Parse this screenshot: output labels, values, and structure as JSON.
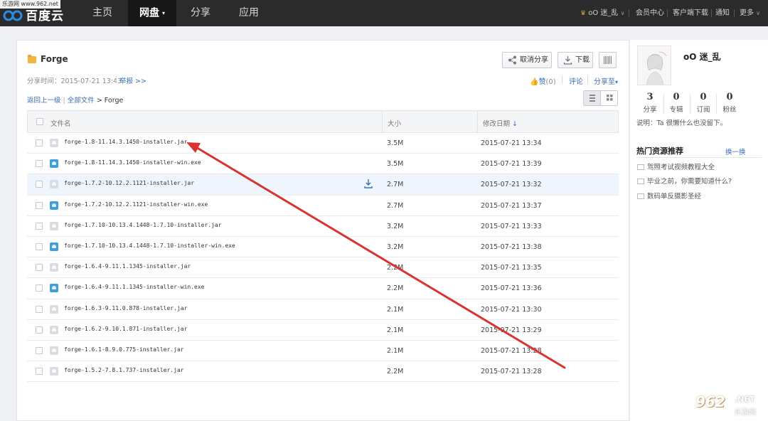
{
  "watermark": {
    "top_left": "乐游网 www.962.net",
    "bottom_right_big": "962",
    "bottom_right_net": ".NET",
    "bottom_right_cn": "乐游网"
  },
  "app": {
    "logo_text": "百度云"
  },
  "nav": {
    "items": [
      {
        "label": "主页"
      },
      {
        "label": "网盘",
        "active": true
      },
      {
        "label": "分享"
      },
      {
        "label": "应用"
      }
    ],
    "user": "oO 迷_乱",
    "links": [
      "会员中心",
      "客户端下载",
      "通知",
      "更多"
    ]
  },
  "share": {
    "folder_name": "Forge",
    "share_time": "分享时间：2015-07-21 13:43",
    "report": "举报 >>",
    "cancel_share": "取消分享",
    "download": "下载",
    "like": "赞",
    "like_count": "(0)",
    "comment": "评论",
    "share_to": "分享至",
    "breadcrumb": {
      "back": "返回上一级",
      "all_files": "全部文件",
      "current": "> Forge"
    }
  },
  "table": {
    "headers": {
      "name": "文件名",
      "size": "大小",
      "date": "修改日期"
    },
    "rows": [
      {
        "name": "forge-1.8-11.14.3.1450-installer.jar",
        "type": "jar",
        "size": "3.5M",
        "date": "2015-07-21 13:34"
      },
      {
        "name": "forge-1.8-11.14.3.1450-installer-win.exe",
        "type": "exe",
        "size": "3.5M",
        "date": "2015-07-21 13:39"
      },
      {
        "name": "forge-1.7.2-10.12.2.1121-installer.jar",
        "type": "jar",
        "size": "2.7M",
        "date": "2015-07-21 13:32",
        "hover": true
      },
      {
        "name": "forge-1.7.2-10.12.2.1121-installer-win.exe",
        "type": "exe",
        "size": "2.7M",
        "date": "2015-07-21 13:37"
      },
      {
        "name": "forge-1.7.10-10.13.4.1448-1.7.10-installer.jar",
        "type": "jar",
        "size": "3.2M",
        "date": "2015-07-21 13:33"
      },
      {
        "name": "forge-1.7.10-10.13.4.1448-1.7.10-installer-win.exe",
        "type": "exe",
        "size": "3.2M",
        "date": "2015-07-21 13:38"
      },
      {
        "name": "forge-1.6.4-9.11.1.1345-installer.jar",
        "type": "jar",
        "size": "2.2M",
        "date": "2015-07-21 13:35"
      },
      {
        "name": "forge-1.6.4-9.11.1.1345-installer-win.exe",
        "type": "exe",
        "size": "2.2M",
        "date": "2015-07-21 13:36"
      },
      {
        "name": "forge-1.6.3-9.11.0.878-installer.jar",
        "type": "jar",
        "size": "2.1M",
        "date": "2015-07-21 13:30"
      },
      {
        "name": "forge-1.6.2-9.10.1.871-installer.jar",
        "type": "jar",
        "size": "2.1M",
        "date": "2015-07-21 13:29"
      },
      {
        "name": "forge-1.6.1-8.9.0.775-installer.jar",
        "type": "jar",
        "size": "2.1M",
        "date": "2015-07-21 13:28"
      },
      {
        "name": "forge-1.5.2-7.8.1.737-installer.jar",
        "type": "jar",
        "size": "2.2M",
        "date": "2015-07-21 13:28"
      }
    ]
  },
  "profile": {
    "name": "oO 迷_乱",
    "stats": [
      {
        "num": "3",
        "label": "分享"
      },
      {
        "num": "0",
        "label": "专辑"
      },
      {
        "num": "0",
        "label": "订阅"
      },
      {
        "num": "0",
        "label": "粉丝"
      }
    ],
    "bio": "说明：Ta 很懒什么也没留下。"
  },
  "hot": {
    "title": "热门资源推荐",
    "more": "换一换",
    "items": [
      "驾照考试视频教程大全",
      "毕业之前，你需要知道什么?",
      "数码单反摄影圣经"
    ]
  },
  "colors": {
    "topbar": "#2b2b2b",
    "link": "#3a6fb4",
    "arrow": "#d9342f",
    "folder": "#f3b53a",
    "exe_icon": "#3fa0d9"
  }
}
